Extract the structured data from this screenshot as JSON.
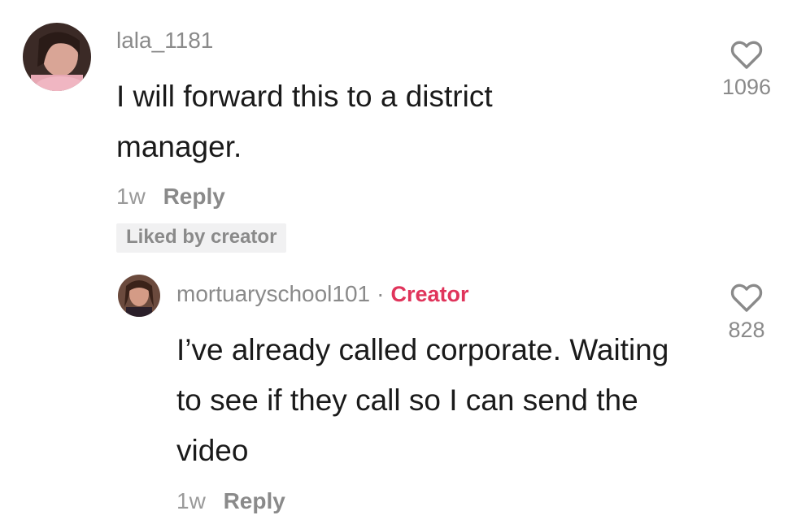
{
  "comment": {
    "username": "lala_1181",
    "text": "I will forward this to a district manager.",
    "time": "1w",
    "reply_label": "Reply",
    "badge": "Liked by creator",
    "likes": "1096",
    "avatar_icon": "user-avatar"
  },
  "reply": {
    "username": "mortuaryschool101",
    "separator": "·",
    "creator_label": "Creator",
    "text": "I’ve already called corporate. Waiting to see if they call so I can send the video",
    "time": "1w",
    "reply_label": "Reply",
    "likes": "828",
    "avatar_icon": "user-avatar"
  },
  "icons": {
    "like": "heart-outline-icon"
  },
  "colors": {
    "creator": "#e0345b",
    "muted": "#8a8a8a",
    "text": "#1a1a1a"
  }
}
